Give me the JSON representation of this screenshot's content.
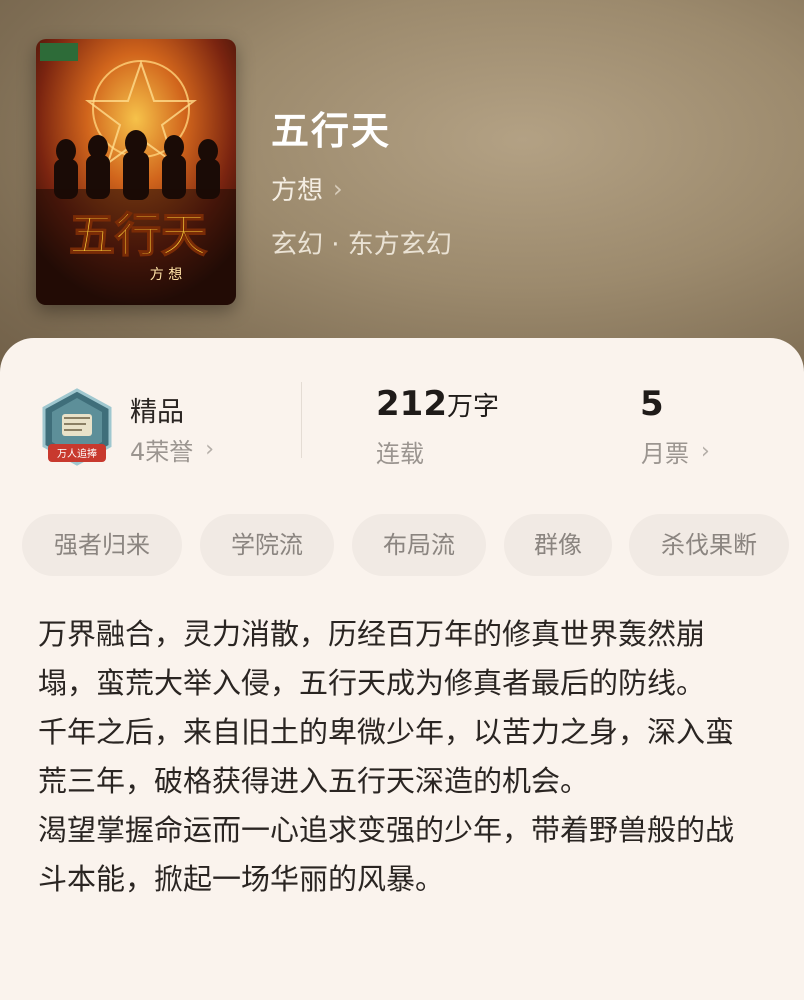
{
  "book": {
    "title": "五行天",
    "author": "方想",
    "genre": "玄幻 · 东方玄幻",
    "cover_title": "五行天",
    "cover_author": "方 想"
  },
  "stats": {
    "quality_label": "精品",
    "honor_label": "4荣誉",
    "badge_text": "万人追捧",
    "word_count": "212",
    "word_unit": "万字",
    "status": "连载",
    "monthly_tickets": "5",
    "monthly_tickets_label": "月票"
  },
  "tags": [
    "强者归来",
    "学院流",
    "布局流",
    "群像",
    "杀伐果断"
  ],
  "description": [
    "万界融合，灵力消散，历经百万年的修真世界轰然崩塌，蛮荒大举入侵，五行天成为修真者最后的防线。",
    "千年之后，来自旧土的卑微少年，以苦力之身，深入蛮荒三年，破格获得进入五行天深造的机会。",
    "渴望掌握命运而一心追求变强的少年，带着野兽般的战斗本能，掀起一场华丽的风暴。"
  ],
  "colors": {
    "card_bg": "#faf3ed",
    "tag_bg": "#f1eae4",
    "hero_bg": "#9c8a6d"
  }
}
